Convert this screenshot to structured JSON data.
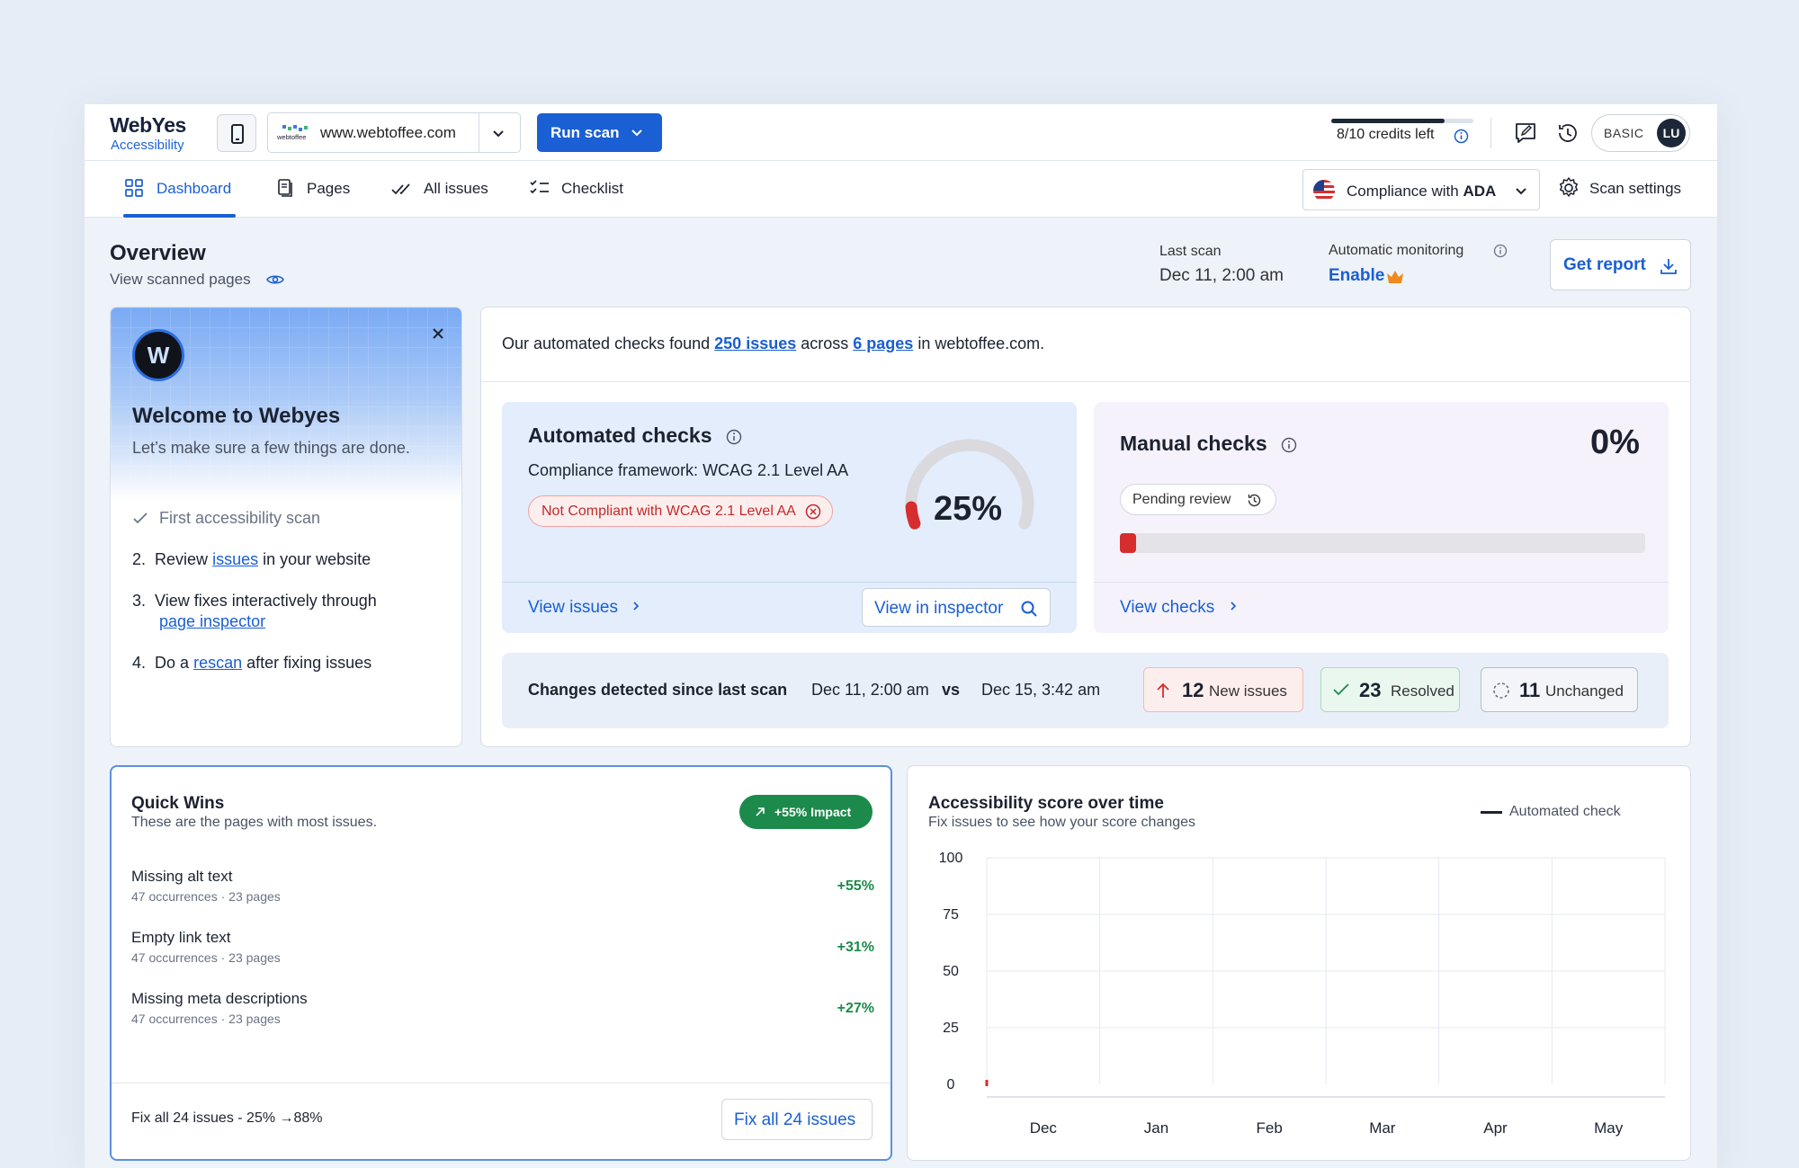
{
  "brand": {
    "name": "WebYes",
    "sub": "Accessibility"
  },
  "topbar": {
    "site_url": "www.webtoffee.com",
    "site_logo_text": "webtoffee",
    "run_scan": "Run scan",
    "credits_text": "8/10 credits left",
    "credits_fraction": 0.8,
    "plan": "BASIC",
    "avatar": "LU"
  },
  "tabs": [
    {
      "label": "Dashboard",
      "active": true,
      "icon": "grid-icon"
    },
    {
      "label": "Pages",
      "icon": "pages-icon"
    },
    {
      "label": "All issues",
      "icon": "double-check-icon"
    },
    {
      "label": "Checklist",
      "icon": "checklist-icon"
    }
  ],
  "compliance": {
    "prefix": "Compliance with",
    "standard": "ADA"
  },
  "scan_settings": "Scan settings",
  "overview": {
    "title": "Overview",
    "sub": "View scanned pages",
    "last_scan_label": "Last scan",
    "last_scan_value": "Dec 11, 2:00 am",
    "monitoring_label": "Automatic monitoring",
    "monitoring_value": "Enable",
    "report": "Get report"
  },
  "welcome": {
    "logo_letter": "W",
    "title": "Welcome to Webyes",
    "sub": "Let’s make sure a few things are done.",
    "step1": "First accessibility scan",
    "step2_num": "2.",
    "step2_a": "Review",
    "step2_link": "issues",
    "step2_b": "in your website",
    "step3_num": "3.",
    "step3_a": "View fixes interactively through",
    "step3_link": "page inspector",
    "step4_num": "4.",
    "step4_a": "Do a",
    "step4_link": "rescan",
    "step4_b": "after fixing issues"
  },
  "summary": {
    "a": "Our automated checks found",
    "issues": "250 issues",
    "b": "across",
    "pages": "6 pages",
    "c": "in webtoffee.com."
  },
  "automated": {
    "title": "Automated checks",
    "framework": "Compliance framework: WCAG 2.1 Level AA",
    "badge": "Not Compliant with WCAG 2.1 Level AA",
    "percent_text": "25%",
    "percent": 25,
    "view_issues": "View issues",
    "inspector": "View in inspector"
  },
  "manual": {
    "title": "Manual checks",
    "percent_text": "0%",
    "pill": "Pending review",
    "progress": 0.03,
    "view_checks": "View checks"
  },
  "changes": {
    "label": "Changes detected since last scan",
    "from": "Dec 11, 2:00 am",
    "vs": "vs",
    "to": "Dec 15, 3:42 am",
    "new_n": "12",
    "new_t": "New issues",
    "res_n": "23",
    "res_t": "Resolved",
    "unc_n": "11",
    "unc_t": "Unchanged",
    "colors": {
      "new": "#d62e2e",
      "resolved": "#1c8a4a",
      "unchanged": "#6a7384"
    }
  },
  "quick_wins": {
    "title": "Quick Wins",
    "sub": "These are the pages with most issues.",
    "badge": "+55% Impact",
    "rows": [
      {
        "name": "Missing alt text",
        "meta": "47 occurrences · 23 pages",
        "pct": "+55%"
      },
      {
        "name": "Empty link text",
        "meta": "47 occurrences · 23 pages",
        "pct": "+31%"
      },
      {
        "name": "Missing meta descriptions",
        "meta": "47 occurrences · 23 pages",
        "pct": "+27%"
      }
    ],
    "footer": "Fix all 24 issues - 25% →88%",
    "fix_btn": "Fix all 24 issues"
  },
  "score_chart": {
    "title": "Accessibility score over time",
    "sub": "Fix issues to see how your score changes",
    "legend": "Automated check"
  },
  "chart_data": {
    "type": "bar",
    "title": "Accessibility score over time",
    "subtitle": "Fix issues to see how your score changes",
    "categories": [
      "Dec",
      "Jan",
      "Feb",
      "Mar",
      "Apr",
      "May"
    ],
    "series": [
      {
        "name": "Automated check",
        "values": [
          2,
          null,
          null,
          null,
          null,
          null
        ]
      }
    ],
    "yticks": [
      "100",
      "75",
      "50",
      "25",
      "0"
    ],
    "ylim": [
      0,
      100
    ],
    "grid": true,
    "legend": "top-right",
    "bar_color": "#d62e2e"
  }
}
